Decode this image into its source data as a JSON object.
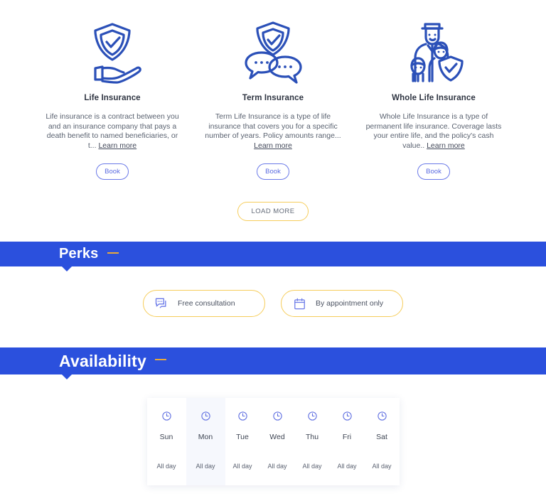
{
  "services": {
    "cards": [
      {
        "icon": "shield-hand-icon",
        "title": "Life Insurance",
        "description": "Life insurance is a contract between you and an insurance company that pays a death benefit to named beneficiaries, or t...",
        "learn_more": "Learn more",
        "book_label": "Book"
      },
      {
        "icon": "shield-chat-icon",
        "title": "Term Insurance",
        "description": "Term Life Insurance is a type of life insurance that covers you for a specific number of years. Policy amounts range...",
        "learn_more": "Learn more",
        "book_label": "Book"
      },
      {
        "icon": "family-shield-icon",
        "title": "Whole Life Insurance",
        "description": "Whole Life Insurance is a type of permanent life insurance. Coverage lasts your entire life, and the policy's cash value..",
        "learn_more": "Learn more",
        "book_label": "Book"
      }
    ],
    "load_more_label": "LOAD MORE"
  },
  "perks": {
    "heading": "Perks",
    "items": [
      {
        "icon": "chat-bubbles-icon",
        "label": "Free consultation"
      },
      {
        "icon": "calendar-icon",
        "label": "By appointment only"
      }
    ]
  },
  "availability": {
    "heading": "Availability",
    "days": [
      {
        "icon": "clock-icon",
        "day": "Sun",
        "hours": "All day",
        "highlighted": false
      },
      {
        "icon": "clock-icon",
        "day": "Mon",
        "hours": "All day",
        "highlighted": true
      },
      {
        "icon": "clock-icon",
        "day": "Tue",
        "hours": "All day",
        "highlighted": false
      },
      {
        "icon": "clock-icon",
        "day": "Wed",
        "hours": "All day",
        "highlighted": false
      },
      {
        "icon": "clock-icon",
        "day": "Thu",
        "hours": "All day",
        "highlighted": false
      },
      {
        "icon": "clock-icon",
        "day": "Fri",
        "hours": "All day",
        "highlighted": false
      },
      {
        "icon": "clock-icon",
        "day": "Sat",
        "hours": "All day",
        "highlighted": false
      }
    ]
  },
  "colors": {
    "brand_blue": "#2b50dd",
    "icon_blue": "#2b50b8",
    "accent_yellow": "#f6cd5b",
    "accent_orange": "#e9a93a",
    "button_blue": "#5b6be0"
  }
}
